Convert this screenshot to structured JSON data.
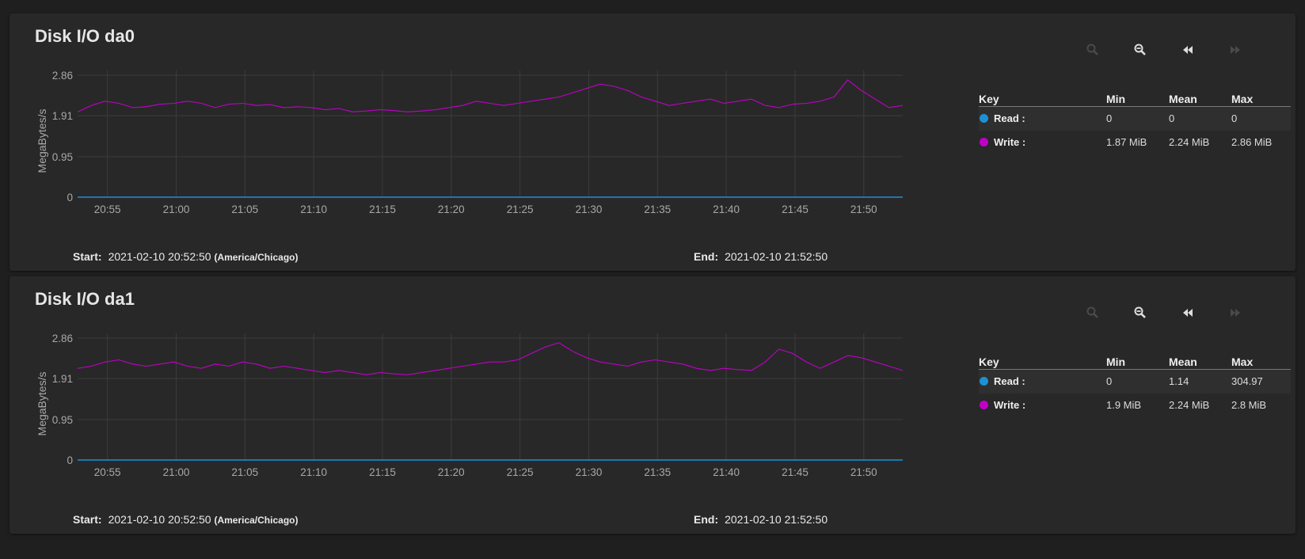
{
  "panels": [
    {
      "title": "Disk I/O da0",
      "start_label": "Start:",
      "start_value": "2021-02-10 20:52:50",
      "timezone": "(America/Chicago)",
      "end_label": "End:",
      "end_value": "2021-02-10 21:52:50",
      "legend": {
        "headers": [
          "Key",
          "Min",
          "Mean",
          "Max"
        ],
        "rows": [
          {
            "name": "Read :",
            "min": "0",
            "mean": "0",
            "max": "0",
            "color": "#1e90d6"
          },
          {
            "name": "Write :",
            "min": "1.87 MiB",
            "mean": "2.24 MiB",
            "max": "2.86 MiB",
            "color": "#c000c8"
          }
        ]
      }
    },
    {
      "title": "Disk I/O da1",
      "start_label": "Start:",
      "start_value": "2021-02-10 20:52:50",
      "timezone": "(America/Chicago)",
      "end_label": "End:",
      "end_value": "2021-02-10 21:52:50",
      "legend": {
        "headers": [
          "Key",
          "Min",
          "Mean",
          "Max"
        ],
        "rows": [
          {
            "name": "Read :",
            "min": "0",
            "mean": "1.14",
            "max": "304.97",
            "color": "#1e90d6"
          },
          {
            "name": "Write :",
            "min": "1.9 MiB",
            "mean": "2.24 MiB",
            "max": "2.8 MiB",
            "color": "#c000c8"
          }
        ]
      }
    }
  ],
  "toolbar_icons": [
    "zoom-in-icon",
    "zoom-out-icon",
    "rewind-icon",
    "fast-forward-icon"
  ],
  "chart_data": [
    {
      "type": "line",
      "title": "Disk I/O da0",
      "ylabel": "MegaBytes/s",
      "xlabel": "",
      "ylim": [
        0,
        2.86
      ],
      "y_ticks": [
        "0",
        "0.95",
        "1.91",
        "2.86"
      ],
      "x_ticks": [
        "20:55",
        "21:00",
        "21:05",
        "21:10",
        "21:15",
        "21:20",
        "21:25",
        "21:30",
        "21:35",
        "21:40",
        "21:45",
        "21:50"
      ],
      "x_range": [
        "20:52:50",
        "21:52:50"
      ],
      "grid": true,
      "series": [
        {
          "name": "Read",
          "color": "#1e90d6",
          "values": [
            [
              0,
              0
            ],
            [
              60,
              0
            ]
          ]
        },
        {
          "name": "Write",
          "color": "#c000c8",
          "values": [
            [
              0,
              2.0
            ],
            [
              1,
              2.15
            ],
            [
              2,
              2.25
            ],
            [
              3,
              2.2
            ],
            [
              4,
              2.1
            ],
            [
              5,
              2.12
            ],
            [
              6,
              2.18
            ],
            [
              7,
              2.2
            ],
            [
              8,
              2.25
            ],
            [
              9,
              2.2
            ],
            [
              10,
              2.1
            ],
            [
              11,
              2.18
            ],
            [
              12,
              2.2
            ],
            [
              13,
              2.15
            ],
            [
              14,
              2.17
            ],
            [
              15,
              2.1
            ],
            [
              16,
              2.12
            ],
            [
              17,
              2.1
            ],
            [
              18,
              2.05
            ],
            [
              19,
              2.08
            ],
            [
              20,
              2.0
            ],
            [
              21,
              2.02
            ],
            [
              22,
              2.05
            ],
            [
              23,
              2.03
            ],
            [
              24,
              2.0
            ],
            [
              25,
              2.02
            ],
            [
              26,
              2.05
            ],
            [
              27,
              2.1
            ],
            [
              28,
              2.15
            ],
            [
              29,
              2.25
            ],
            [
              30,
              2.2
            ],
            [
              31,
              2.15
            ],
            [
              32,
              2.2
            ],
            [
              33,
              2.25
            ],
            [
              34,
              2.3
            ],
            [
              35,
              2.35
            ],
            [
              36,
              2.45
            ],
            [
              37,
              2.55
            ],
            [
              38,
              2.65
            ],
            [
              39,
              2.6
            ],
            [
              40,
              2.5
            ],
            [
              41,
              2.35
            ],
            [
              42,
              2.25
            ],
            [
              43,
              2.15
            ],
            [
              44,
              2.2
            ],
            [
              45,
              2.25
            ],
            [
              46,
              2.3
            ],
            [
              47,
              2.2
            ],
            [
              48,
              2.25
            ],
            [
              49,
              2.3
            ],
            [
              50,
              2.15
            ],
            [
              51,
              2.1
            ],
            [
              52,
              2.18
            ],
            [
              53,
              2.2
            ],
            [
              54,
              2.25
            ],
            [
              55,
              2.35
            ],
            [
              56,
              2.75
            ],
            [
              57,
              2.5
            ],
            [
              58,
              2.3
            ],
            [
              59,
              2.1
            ],
            [
              60,
              2.15
            ]
          ]
        }
      ]
    },
    {
      "type": "line",
      "title": "Disk I/O da1",
      "ylabel": "MegaBytes/s",
      "xlabel": "",
      "ylim": [
        0,
        2.86
      ],
      "y_ticks": [
        "0",
        "0.95",
        "1.91",
        "2.86"
      ],
      "x_ticks": [
        "20:55",
        "21:00",
        "21:05",
        "21:10",
        "21:15",
        "21:20",
        "21:25",
        "21:30",
        "21:35",
        "21:40",
        "21:45",
        "21:50"
      ],
      "x_range": [
        "20:52:50",
        "21:52:50"
      ],
      "grid": true,
      "series": [
        {
          "name": "Read",
          "color": "#1e90d6",
          "values": [
            [
              0,
              0
            ],
            [
              60,
              0
            ]
          ]
        },
        {
          "name": "Write",
          "color": "#c000c8",
          "values": [
            [
              0,
              2.15
            ],
            [
              1,
              2.2
            ],
            [
              2,
              2.3
            ],
            [
              3,
              2.35
            ],
            [
              4,
              2.25
            ],
            [
              5,
              2.2
            ],
            [
              6,
              2.25
            ],
            [
              7,
              2.3
            ],
            [
              8,
              2.2
            ],
            [
              9,
              2.15
            ],
            [
              10,
              2.25
            ],
            [
              11,
              2.2
            ],
            [
              12,
              2.3
            ],
            [
              13,
              2.25
            ],
            [
              14,
              2.15
            ],
            [
              15,
              2.2
            ],
            [
              16,
              2.15
            ],
            [
              17,
              2.1
            ],
            [
              18,
              2.05
            ],
            [
              19,
              2.1
            ],
            [
              20,
              2.05
            ],
            [
              21,
              2.0
            ],
            [
              22,
              2.05
            ],
            [
              23,
              2.02
            ],
            [
              24,
              2.0
            ],
            [
              25,
              2.05
            ],
            [
              26,
              2.1
            ],
            [
              27,
              2.15
            ],
            [
              28,
              2.2
            ],
            [
              29,
              2.25
            ],
            [
              30,
              2.3
            ],
            [
              31,
              2.3
            ],
            [
              32,
              2.35
            ],
            [
              33,
              2.5
            ],
            [
              34,
              2.65
            ],
            [
              35,
              2.75
            ],
            [
              36,
              2.55
            ],
            [
              37,
              2.4
            ],
            [
              38,
              2.3
            ],
            [
              39,
              2.25
            ],
            [
              40,
              2.2
            ],
            [
              41,
              2.3
            ],
            [
              42,
              2.35
            ],
            [
              43,
              2.3
            ],
            [
              44,
              2.25
            ],
            [
              45,
              2.15
            ],
            [
              46,
              2.1
            ],
            [
              47,
              2.15
            ],
            [
              48,
              2.12
            ],
            [
              49,
              2.1
            ],
            [
              50,
              2.3
            ],
            [
              51,
              2.6
            ],
            [
              52,
              2.5
            ],
            [
              53,
              2.3
            ],
            [
              54,
              2.15
            ],
            [
              55,
              2.3
            ],
            [
              56,
              2.45
            ],
            [
              57,
              2.4
            ],
            [
              58,
              2.3
            ],
            [
              59,
              2.2
            ],
            [
              60,
              2.1
            ]
          ]
        }
      ]
    }
  ]
}
